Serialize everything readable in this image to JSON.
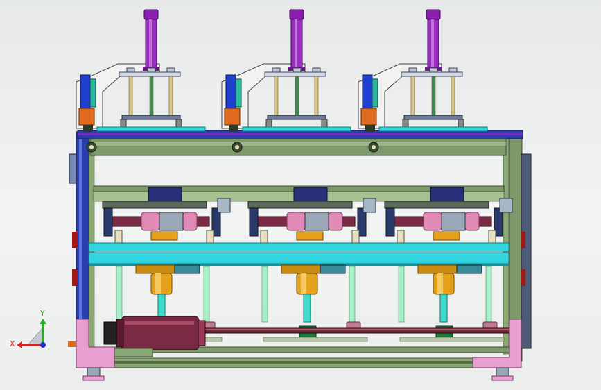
{
  "viewport": {
    "background": "#eef0ef"
  },
  "machine": {
    "station_count": 3,
    "colors": {
      "frame_blue": "#2a3fae",
      "frame_green": "#7e9a6a",
      "cylinder_purple": "#9a2fbf",
      "guide_rod": "#d8c68a",
      "arm_white": "#f2f2f0",
      "cyan_rail": "#33d6e0",
      "motor_maroon": "#7a2a43",
      "bearing_pink": "#e08ab5",
      "gear_orange": "#e6a21c",
      "corner_pink": "#e8a0d0",
      "light_green_column": "#a8f0c8",
      "navy_block": "#2a2f7a"
    }
  },
  "triad": {
    "x_label": "X",
    "y_label": "Y",
    "x_color": "#e02020",
    "y_color": "#20b020",
    "z_color": "#2030d0"
  }
}
